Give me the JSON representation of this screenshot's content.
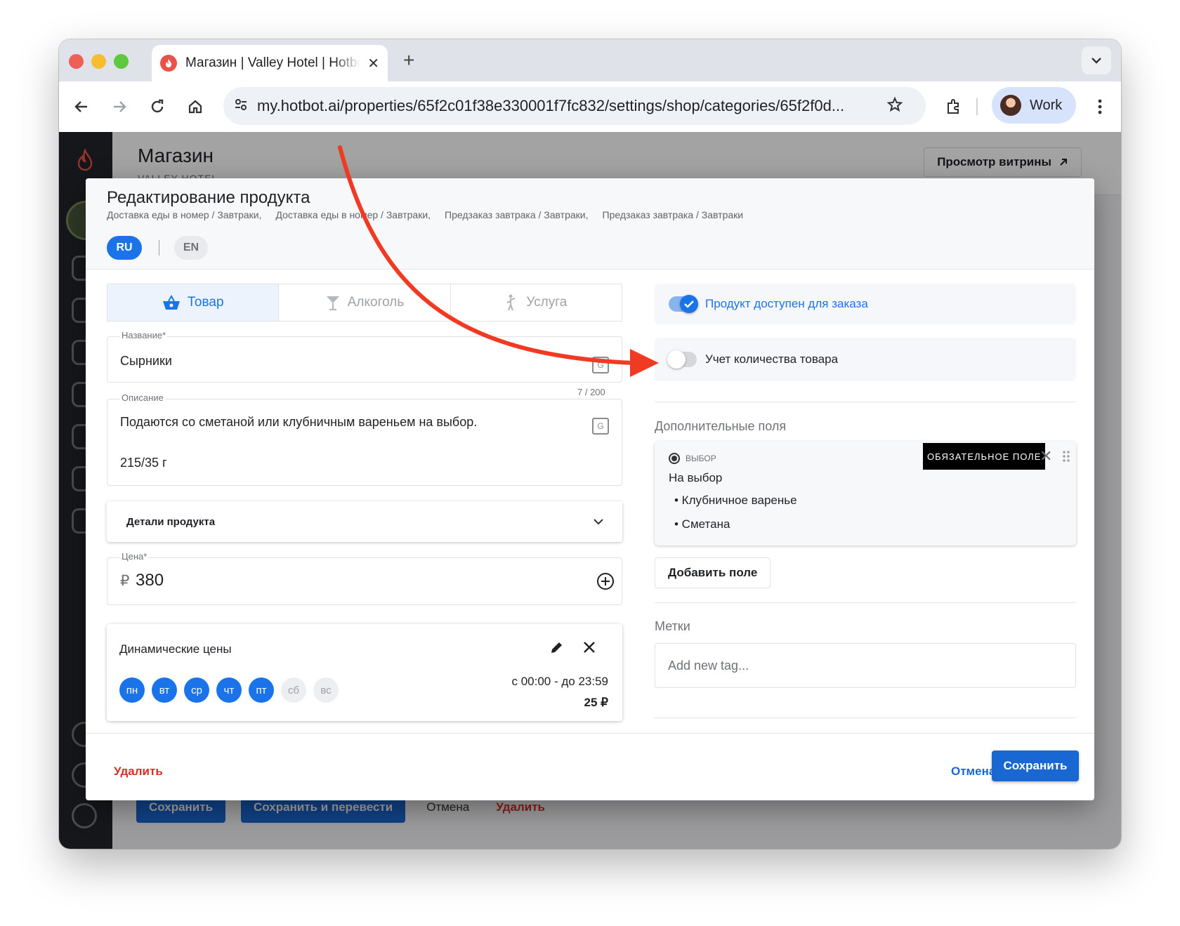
{
  "browser": {
    "tab_title": "Магазин | Valley Hotel | Hotbot",
    "url": "my.hotbot.ai/properties/65f2c01f38e330001f7fc832/settings/shop/categories/65f2f0d...",
    "profile_label": "Work",
    "traffic_lights": [
      "#ee5f57",
      "#f5bd2f",
      "#5fc83f"
    ]
  },
  "page": {
    "title": "Магазин",
    "subtitle": "VALLEY HOTEL",
    "storefront_button": "Просмотр витрины",
    "bottom_actions": {
      "save": "Сохранить",
      "save_translate": "Сохранить и перевести",
      "cancel": "Отмена",
      "delete": "Удалить"
    }
  },
  "modal": {
    "title": "Редактирование продукта",
    "breadcrumbs": [
      "Доставка еды в номер / Завтраки,",
      "Доставка еды в номер / Завтраки,",
      "Предзаказ завтрака / Завтраки,",
      "Предзаказ завтрака / Завтраки"
    ],
    "languages": [
      {
        "code": "RU",
        "active": true
      },
      {
        "code": "EN",
        "active": false
      }
    ],
    "type_tabs": [
      {
        "label": "Товар",
        "icon": "basket-icon",
        "active": true
      },
      {
        "label": "Алкоголь",
        "icon": "cocktail-icon",
        "active": false
      },
      {
        "label": "Услуга",
        "icon": "person-service-icon",
        "active": false
      }
    ],
    "name_field": {
      "label": "Название*",
      "value": "Сырники"
    },
    "description_field": {
      "label": "Описание",
      "counter": "7 / 200",
      "line1": "Подаются со сметаной или клубничным вареньем на выбор.",
      "line2": "215/35 г"
    },
    "details_accordion": "Детали продукта",
    "price_field": {
      "label": "Цена*",
      "currency": "₽",
      "value": "380"
    },
    "dynamic_prices": {
      "title": "Динамические цены",
      "days": [
        {
          "label": "пн",
          "active": true
        },
        {
          "label": "вт",
          "active": true
        },
        {
          "label": "ср",
          "active": true
        },
        {
          "label": "чт",
          "active": true
        },
        {
          "label": "пт",
          "active": true
        },
        {
          "label": "сб",
          "active": false
        },
        {
          "label": "вс",
          "active": false
        }
      ],
      "time": "с 00:00 - до 23:59",
      "price": "25 ₽"
    },
    "available_toggle": {
      "label": "Продукт доступен для заказа",
      "on": true
    },
    "stock_toggle": {
      "label": "Учет количества товара",
      "on": false
    },
    "extra_fields": {
      "section_label": "Дополнительные поля",
      "type": "Выбор",
      "required_badge": "Обязательное поле",
      "title": "На выбор",
      "options": [
        "• Клубничное варенье",
        "• Сметана"
      ],
      "add_button": "Добавить поле"
    },
    "tags": {
      "section_label": "Метки",
      "placeholder": "Add new tag..."
    },
    "footer": {
      "delete": "Удалить",
      "cancel": "Отмена",
      "save": "Сохранить"
    }
  },
  "colors": {
    "accent": "#1a73e8",
    "danger": "#d93025",
    "annotation_arrow": "#f03a24"
  }
}
